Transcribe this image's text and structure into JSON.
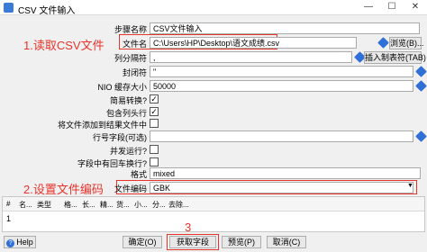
{
  "window": {
    "title": "CSV 文件输入",
    "minimize": "—",
    "maximize": "☐",
    "close": "✕"
  },
  "annotations": {
    "step1": "1.读取CSV文件",
    "step2": "2.设置文件编码",
    "step3": "3"
  },
  "form": {
    "step_name": {
      "label": "步骤名称",
      "value": "CSV文件输入"
    },
    "filename": {
      "label": "文件名",
      "value": "C:\\Users\\HP\\Desktop\\语文成绩.csv",
      "browse": "浏览(B)..."
    },
    "delimiter": {
      "label": "列分隔符",
      "value": ",",
      "insert_tab": "插入制表符(TAB)"
    },
    "enclosure": {
      "label": "封闭符",
      "value": "\""
    },
    "nio_buffer": {
      "label": "NIO 缓存大小",
      "value": "50000"
    },
    "lazy_conversion": {
      "label": "简易转换?",
      "checked": true
    },
    "header_row": {
      "label": "包含列头行",
      "checked": true
    },
    "add_filename": {
      "label": "将文件添加到结果文件中",
      "checked": false
    },
    "row_number_field": {
      "label": "行号字段(可选)",
      "value": ""
    },
    "parallel": {
      "label": "并发运行?",
      "checked": false
    },
    "newlines_in_fields": {
      "label": "字段中有回车换行?",
      "checked": false
    },
    "format": {
      "label": "格式",
      "value": "mixed"
    },
    "encoding": {
      "label": "文件编码",
      "value": "GBK"
    }
  },
  "grid": {
    "columns": [
      "#",
      "名...",
      "类型",
      "格...",
      "长...",
      "精...",
      "货...",
      "小...",
      "分...",
      "去除..."
    ],
    "rows": [
      [
        "1"
      ]
    ]
  },
  "footer": {
    "help": "Help",
    "ok": "确定(O)",
    "get_fields": "获取字段",
    "preview": "预览(P)",
    "cancel": "取消(C)"
  }
}
